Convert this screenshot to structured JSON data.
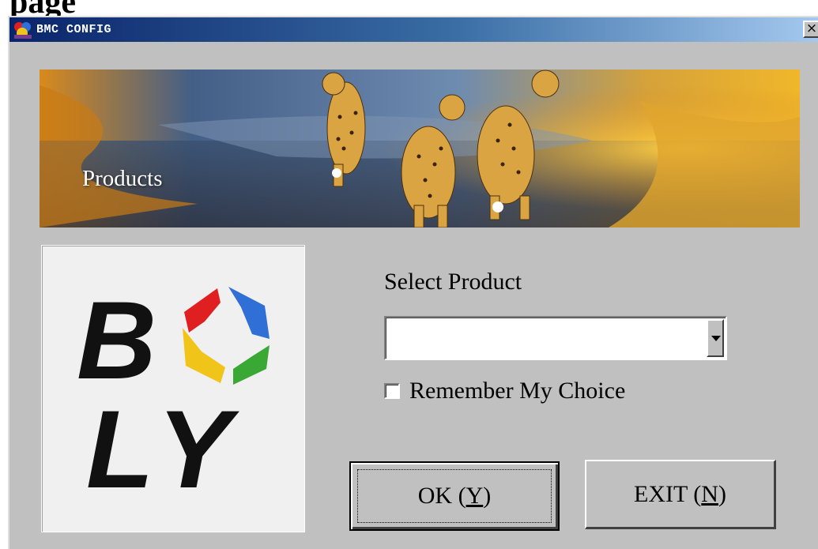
{
  "page": {
    "cropped_header_text": "page"
  },
  "window": {
    "title": "BMC CONFIG",
    "close_glyph": "×"
  },
  "banner": {
    "label": "Products"
  },
  "logo": {
    "brand": "BOLY",
    "colors": [
      "#e02020",
      "#2f6fd6",
      "#f0c419",
      "#3aa835"
    ]
  },
  "form": {
    "select_label": "Select Product",
    "select_value": "",
    "remember_label": "Remember My Choice",
    "remember_checked": false
  },
  "buttons": {
    "ok": {
      "text": "OK (",
      "mnemonic": "Y",
      "suffix": ")"
    },
    "exit": {
      "text": "EXIT (",
      "mnemonic": "N",
      "suffix": ")"
    }
  }
}
